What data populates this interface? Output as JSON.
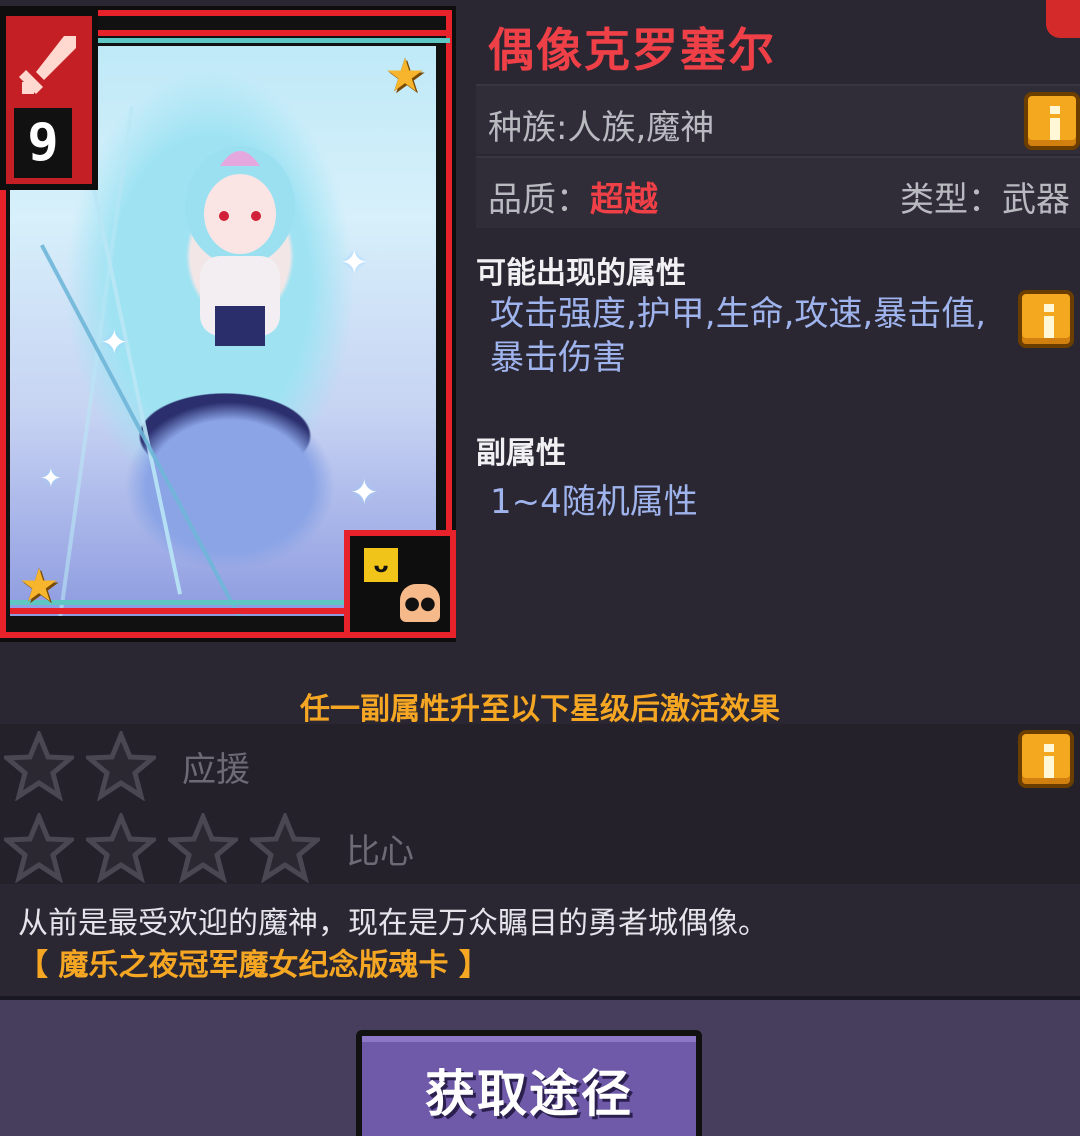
{
  "card": {
    "level": "9",
    "art_alt": "card-illustration",
    "colors": {
      "frame": "#e8222b",
      "badge": "#c41f25"
    }
  },
  "info": {
    "name": "偶像克罗塞尔",
    "race": "种族:人族,魔神",
    "quality_label": "品质：",
    "quality_value": "超越",
    "type": "类型：武器",
    "possible_attrs_title": "可能出现的属性",
    "possible_attrs": "攻击强度,护甲,生命,攻速,暴击值,暴击伤害",
    "sub_attrs_title": "副属性",
    "sub_attrs": "1~4随机属性"
  },
  "activation": {
    "title": "任一副属性升至以下星级后激活效果",
    "effects": [
      {
        "stars": 2,
        "label": "应援"
      },
      {
        "stars": 4,
        "label": "比心"
      }
    ]
  },
  "description": {
    "main": "从前是最受欢迎的魔神，现在是万众瞩目的勇者城偶像。",
    "sub": "【 魔乐之夜冠军魔女纪念版魂卡 】"
  },
  "actions": {
    "acquire_label": "获取途径"
  }
}
